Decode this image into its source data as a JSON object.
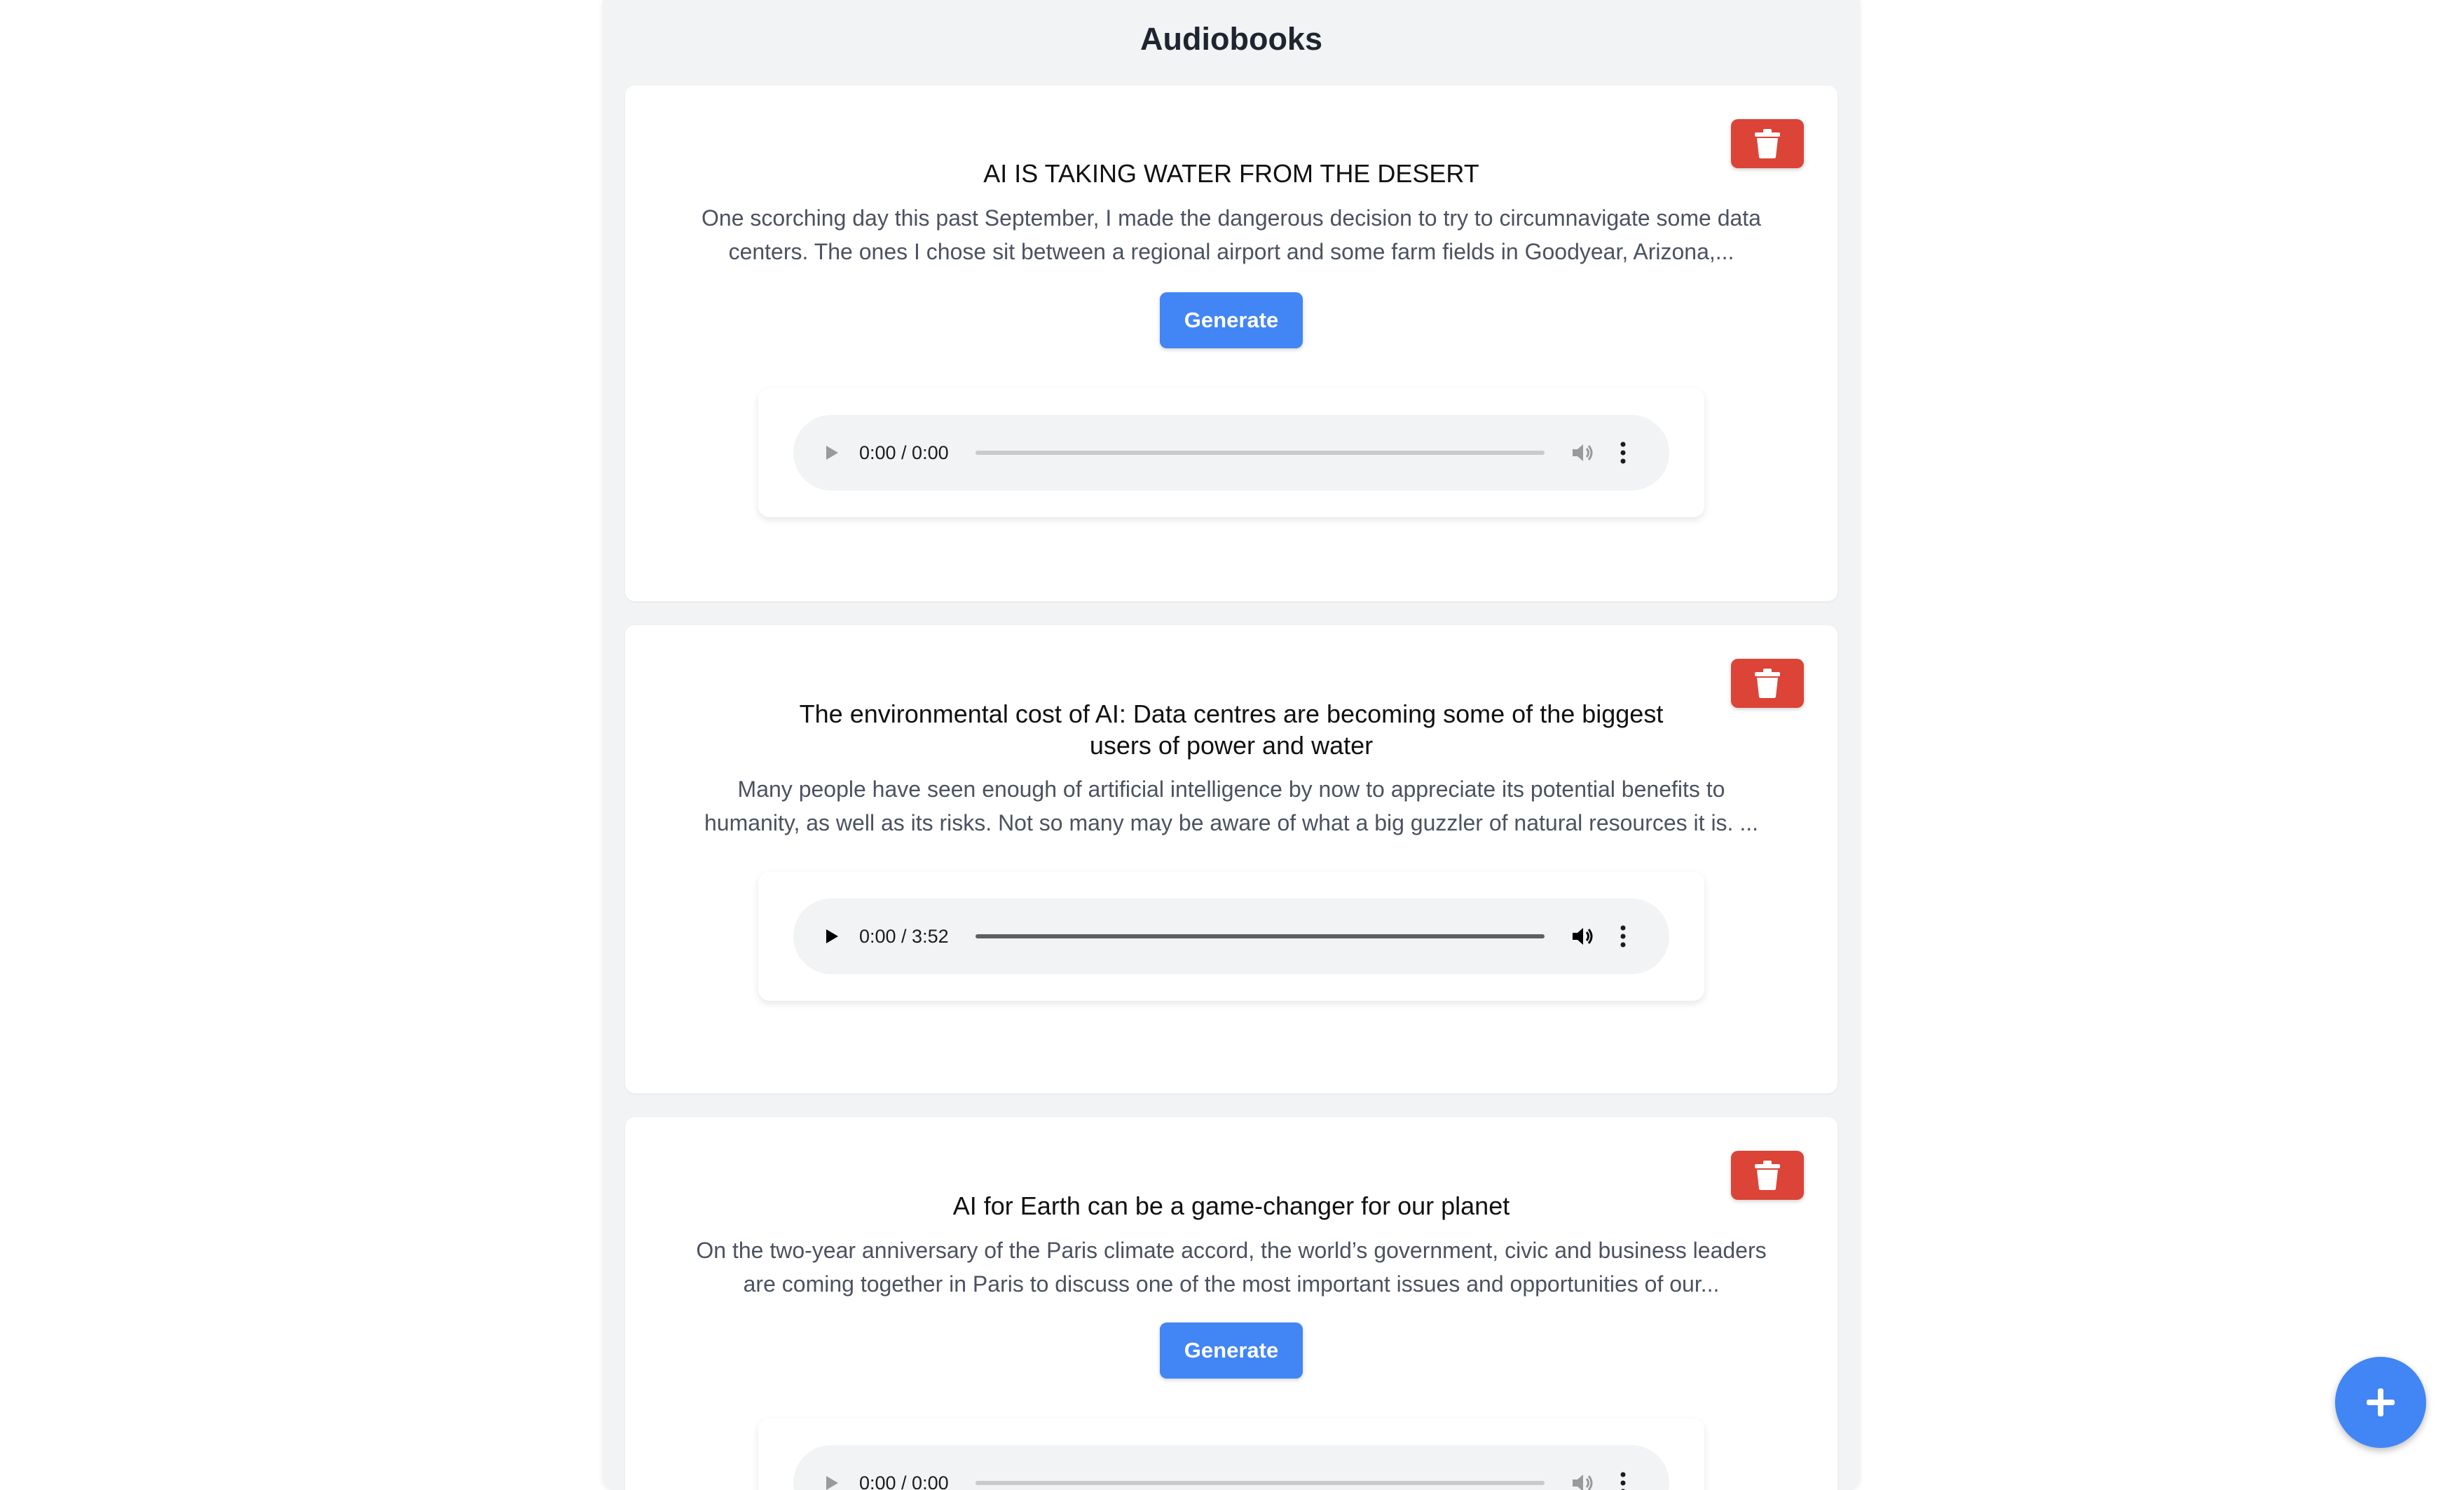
{
  "page": {
    "title": "Audiobooks"
  },
  "cards": [
    {
      "title": "AI IS TAKING WATER FROM THE DESERT",
      "description": "One scorching day this past September, I made the dangerous decision to try to circumnavigate some data centers. The ones I chose sit between a regional airport and some farm fields in Goodyear, Arizona,...",
      "generate_label": "Generate",
      "player": {
        "time": "0:00 / 0:00",
        "enabled": false
      }
    },
    {
      "title": "The environmental cost of AI: Data centres are becoming some of the biggest users of power and water",
      "description": "Many people have seen enough of artificial intelligence by now to appreciate its potential benefits to humanity, as well as its risks. Not so many may be aware of what a big guzzler of natural resources it is. ...",
      "player": {
        "time": "0:00 / 3:52",
        "enabled": true
      }
    },
    {
      "title": "AI for Earth can be a game-changer for our planet",
      "description": "On the two-year anniversary of the Paris climate accord, the world’s government, civic and business leaders are coming together in Paris to discuss one of the most important issues and opportunities of our...",
      "generate_label": "Generate",
      "player": {
        "time": "0:00 / 0:00",
        "enabled": false
      }
    }
  ],
  "icons": {
    "delete": "trash-icon",
    "fab": "plus-icon",
    "play": "play-icon",
    "volume": "volume-icon",
    "more": "more-vertical-icon"
  },
  "colors": {
    "delete": "#db4437",
    "primary": "#4285f4",
    "panel": "#f2f3f4"
  }
}
